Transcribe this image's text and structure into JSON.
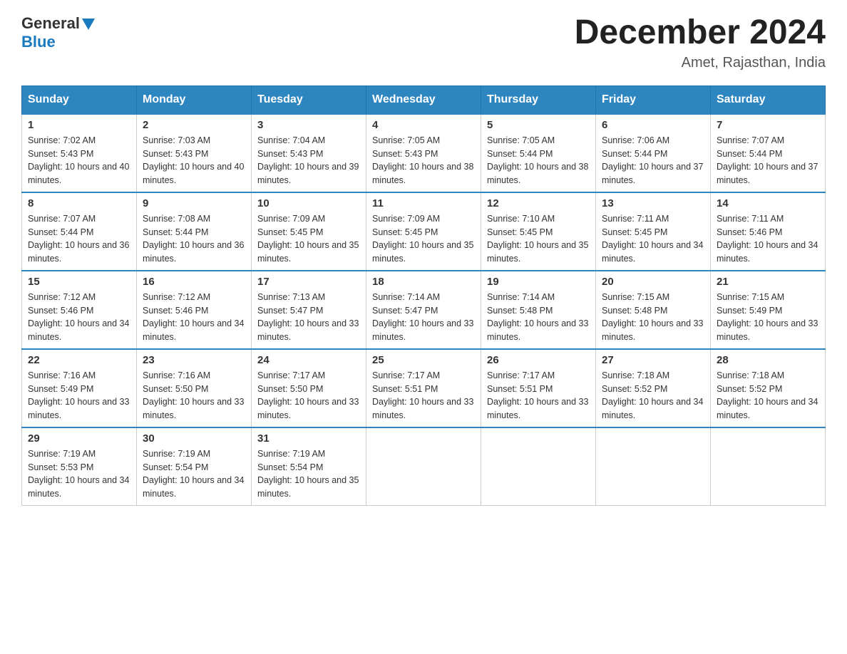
{
  "header": {
    "logo_general": "General",
    "logo_blue": "Blue",
    "month_title": "December 2024",
    "location": "Amet, Rajasthan, India"
  },
  "days_of_week": [
    "Sunday",
    "Monday",
    "Tuesday",
    "Wednesday",
    "Thursday",
    "Friday",
    "Saturday"
  ],
  "weeks": [
    [
      {
        "day": "1",
        "sunrise": "7:02 AM",
        "sunset": "5:43 PM",
        "daylight": "10 hours and 40 minutes."
      },
      {
        "day": "2",
        "sunrise": "7:03 AM",
        "sunset": "5:43 PM",
        "daylight": "10 hours and 40 minutes."
      },
      {
        "day": "3",
        "sunrise": "7:04 AM",
        "sunset": "5:43 PM",
        "daylight": "10 hours and 39 minutes."
      },
      {
        "day": "4",
        "sunrise": "7:05 AM",
        "sunset": "5:43 PM",
        "daylight": "10 hours and 38 minutes."
      },
      {
        "day": "5",
        "sunrise": "7:05 AM",
        "sunset": "5:44 PM",
        "daylight": "10 hours and 38 minutes."
      },
      {
        "day": "6",
        "sunrise": "7:06 AM",
        "sunset": "5:44 PM",
        "daylight": "10 hours and 37 minutes."
      },
      {
        "day": "7",
        "sunrise": "7:07 AM",
        "sunset": "5:44 PM",
        "daylight": "10 hours and 37 minutes."
      }
    ],
    [
      {
        "day": "8",
        "sunrise": "7:07 AM",
        "sunset": "5:44 PM",
        "daylight": "10 hours and 36 minutes."
      },
      {
        "day": "9",
        "sunrise": "7:08 AM",
        "sunset": "5:44 PM",
        "daylight": "10 hours and 36 minutes."
      },
      {
        "day": "10",
        "sunrise": "7:09 AM",
        "sunset": "5:45 PM",
        "daylight": "10 hours and 35 minutes."
      },
      {
        "day": "11",
        "sunrise": "7:09 AM",
        "sunset": "5:45 PM",
        "daylight": "10 hours and 35 minutes."
      },
      {
        "day": "12",
        "sunrise": "7:10 AM",
        "sunset": "5:45 PM",
        "daylight": "10 hours and 35 minutes."
      },
      {
        "day": "13",
        "sunrise": "7:11 AM",
        "sunset": "5:45 PM",
        "daylight": "10 hours and 34 minutes."
      },
      {
        "day": "14",
        "sunrise": "7:11 AM",
        "sunset": "5:46 PM",
        "daylight": "10 hours and 34 minutes."
      }
    ],
    [
      {
        "day": "15",
        "sunrise": "7:12 AM",
        "sunset": "5:46 PM",
        "daylight": "10 hours and 34 minutes."
      },
      {
        "day": "16",
        "sunrise": "7:12 AM",
        "sunset": "5:46 PM",
        "daylight": "10 hours and 34 minutes."
      },
      {
        "day": "17",
        "sunrise": "7:13 AM",
        "sunset": "5:47 PM",
        "daylight": "10 hours and 33 minutes."
      },
      {
        "day": "18",
        "sunrise": "7:14 AM",
        "sunset": "5:47 PM",
        "daylight": "10 hours and 33 minutes."
      },
      {
        "day": "19",
        "sunrise": "7:14 AM",
        "sunset": "5:48 PM",
        "daylight": "10 hours and 33 minutes."
      },
      {
        "day": "20",
        "sunrise": "7:15 AM",
        "sunset": "5:48 PM",
        "daylight": "10 hours and 33 minutes."
      },
      {
        "day": "21",
        "sunrise": "7:15 AM",
        "sunset": "5:49 PM",
        "daylight": "10 hours and 33 minutes."
      }
    ],
    [
      {
        "day": "22",
        "sunrise": "7:16 AM",
        "sunset": "5:49 PM",
        "daylight": "10 hours and 33 minutes."
      },
      {
        "day": "23",
        "sunrise": "7:16 AM",
        "sunset": "5:50 PM",
        "daylight": "10 hours and 33 minutes."
      },
      {
        "day": "24",
        "sunrise": "7:17 AM",
        "sunset": "5:50 PM",
        "daylight": "10 hours and 33 minutes."
      },
      {
        "day": "25",
        "sunrise": "7:17 AM",
        "sunset": "5:51 PM",
        "daylight": "10 hours and 33 minutes."
      },
      {
        "day": "26",
        "sunrise": "7:17 AM",
        "sunset": "5:51 PM",
        "daylight": "10 hours and 33 minutes."
      },
      {
        "day": "27",
        "sunrise": "7:18 AM",
        "sunset": "5:52 PM",
        "daylight": "10 hours and 34 minutes."
      },
      {
        "day": "28",
        "sunrise": "7:18 AM",
        "sunset": "5:52 PM",
        "daylight": "10 hours and 34 minutes."
      }
    ],
    [
      {
        "day": "29",
        "sunrise": "7:19 AM",
        "sunset": "5:53 PM",
        "daylight": "10 hours and 34 minutes."
      },
      {
        "day": "30",
        "sunrise": "7:19 AM",
        "sunset": "5:54 PM",
        "daylight": "10 hours and 34 minutes."
      },
      {
        "day": "31",
        "sunrise": "7:19 AM",
        "sunset": "5:54 PM",
        "daylight": "10 hours and 35 minutes."
      },
      null,
      null,
      null,
      null
    ]
  ],
  "labels": {
    "sunrise_prefix": "Sunrise: ",
    "sunset_prefix": "Sunset: ",
    "daylight_prefix": "Daylight: "
  }
}
